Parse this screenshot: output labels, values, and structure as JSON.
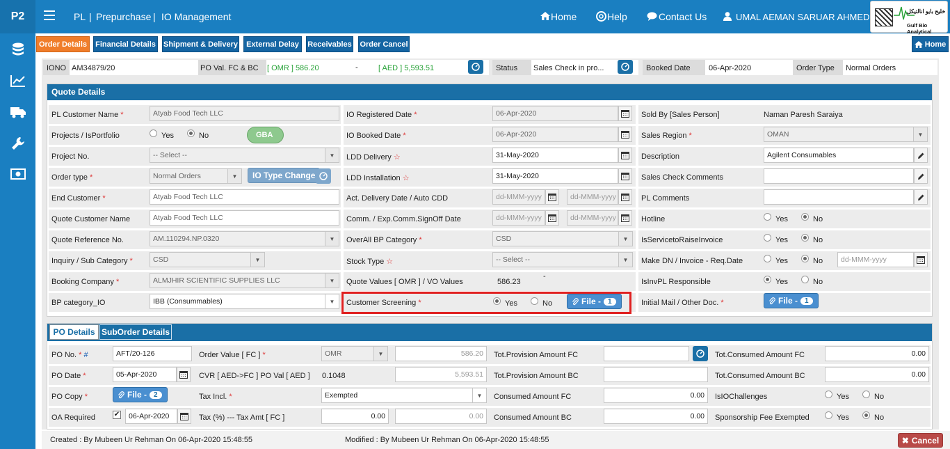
{
  "brand": "P2",
  "breadcrumb": {
    "a": "PL",
    "b": "Prepurchase",
    "c": "IO Management"
  },
  "nav": {
    "home": "Home",
    "help": "Help",
    "contact": "Contact Us",
    "user": "UMAL AEMAN SARUAR AHMEDI"
  },
  "logo": {
    "name": "Gulf Bio Analytical",
    "arabic": "خليج بايو انالتيكل"
  },
  "tabs": [
    "Order Details",
    "Financial Details",
    "Shipment & Delivery",
    "External Delay",
    "Receivables",
    "Order Cancel"
  ],
  "home_btn": "Home",
  "info": {
    "iono_label": "IONO",
    "iono": "AM34879/20",
    "poval_label": "PO Val. FC & BC",
    "poval_fc": "[ OMR ] 586.20",
    "dash": "-",
    "poval_bc": "[ AED ] 5,593.51",
    "status_label": "Status",
    "status": "Sales Check in pro...",
    "booked_label": "Booked Date",
    "booked": "06-Apr-2020",
    "ordertype_label": "Order Type",
    "ordertype": "Normal Orders"
  },
  "quote": {
    "title": "Quote Details",
    "pl_customer_label": "PL Customer Name",
    "pl_customer": "Atyab Food Tech LLC",
    "projects_label": "Projects / IsPortfolio",
    "yes": "Yes",
    "no": "No",
    "gba": "GBA",
    "project_no_label": "Project No.",
    "project_no": "-- Select --",
    "order_type_label": "Order type",
    "order_type": "Normal Orders",
    "io_type_change": "IO Type Change",
    "end_customer_label": "End Customer",
    "end_customer": "Atyab Food Tech LLC",
    "quote_customer_label": "Quote Customer Name",
    "quote_customer": "Atyab Food Tech LLC",
    "quote_ref_label": "Quote Reference No.",
    "quote_ref": "AM.110294.NP.0320",
    "inquiry_label": "Inquiry / Sub Category",
    "inquiry": "CSD",
    "booking_label": "Booking Company",
    "booking": "ALMJHIR SCIENTIFIC SUPPLIES LLC",
    "bp_label": "BP category_IO",
    "bp": "IBB (Consummables)",
    "io_reg_label": "IO Registered Date",
    "io_reg": "06-Apr-2020",
    "io_booked_label": "IO Booked Date",
    "io_booked": "06-Apr-2020",
    "ldd_label": "LDD Delivery",
    "ldd": "31-May-2020",
    "ldd_inst_label": "LDD Installation",
    "ldd_inst": "31-May-2020",
    "act_del_label": "Act. Delivery Date / Auto CDD",
    "date_ph": "dd-MMM-yyyy",
    "comm_label": "Comm. / Exp.Comm.SignOff Date",
    "overall_bp_label": "OverAll BP Category",
    "overall_bp": "CSD",
    "stock_label": "Stock Type",
    "stock": "-- Select --",
    "quote_values_label": "Quote Values [ OMR ] / VO Values",
    "quote_values": "586.23",
    "quote_values_dash": "-",
    "screening_label": "Customer Screening",
    "file_label": "File -",
    "file_count": "1",
    "sold_by_label": "Sold By [Sales Person]",
    "sold_by": "Naman Paresh Saraiya",
    "region_label": "Sales Region",
    "region": "OMAN",
    "desc_label": "Description",
    "desc": "Agilent Consumables",
    "sales_comments_label": "Sales Check Comments",
    "pl_comments_label": "PL Comments",
    "hotline_label": "Hotline",
    "service_label": "IsServicetoRaiseInvoice",
    "make_dn_label": "Make DN / Invoice - Req.Date",
    "isinv_label": "IsInvPL Responsible",
    "initial_mail_label": "Initial Mail / Other Doc."
  },
  "po": {
    "tab1": "PO Details",
    "tab2": "SubOrder Details",
    "po_no_label": "PO No.",
    "hash": "#",
    "po_no": "AFT/20-126",
    "po_date_label": "PO Date",
    "po_date": "05-Apr-2020",
    "po_copy_label": "PO Copy",
    "po_copy_count": "2",
    "oa_label": "OA Required",
    "oa_date": "06-Apr-2020",
    "order_value_label": "Order Value [ FC ]",
    "currency": "OMR",
    "order_value": "586.20",
    "cvr_label": "CVR [ AED->FC ] PO Val [ AED ]",
    "cvr": "0.1048",
    "po_val_aed": "5,593.51",
    "tax_incl_label": "Tax Incl.",
    "tax_incl": "Exempted",
    "tax_label": "Tax (%) --- Tax Amt [ FC ]",
    "tax_pct": "0.00",
    "tax_amt": "0.00",
    "prov_fc_label": "Tot.Provision Amount FC",
    "prov_bc_label": "Tot.Provision Amount BC",
    "cons_fc_label": "Consumed Amount FC",
    "cons_fc": "0.00",
    "cons_bc_label": "Consumed Amount BC",
    "cons_bc": "0.00",
    "tot_cons_fc_label": "Tot.Consumed Amount FC",
    "tot_cons_fc": "0.00",
    "tot_cons_bc_label": "Tot.Consumed Amount BC",
    "tot_cons_bc": "0.00",
    "isio_label": "IsIOChallenges",
    "sponsor_label": "Sponsorship Fee Exempted"
  },
  "footer": {
    "created": "Created : By Mubeen Ur Rehman On 06-Apr-2020 15:48:55",
    "modified": "Modified : By Mubeen Ur Rehman On 06-Apr-2020 15:48:55",
    "cancel": "Cancel"
  },
  "colors": {
    "primary": "#1a7fc1",
    "active_tab": "#f07d2a",
    "highlight": "#e02020"
  }
}
